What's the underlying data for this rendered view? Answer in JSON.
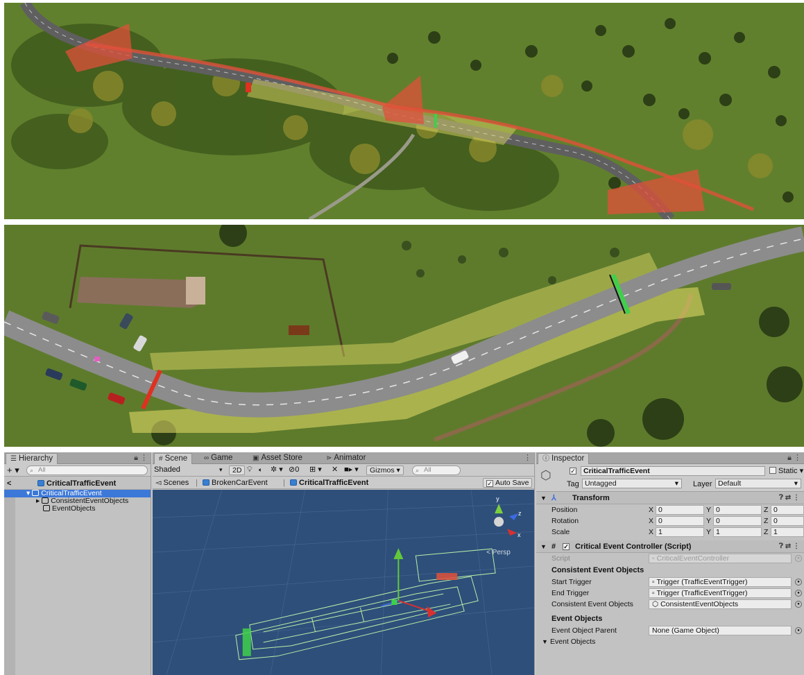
{
  "hierarchy": {
    "tab_label": "Hierarchy",
    "search_placeholder": "All",
    "scene_name": "CriticalTrafficEvent",
    "root_item": "CriticalTrafficEvent",
    "children": [
      "ConsistentEventObjects",
      "EventObjects"
    ]
  },
  "scene_panel": {
    "tabs": [
      "Scene",
      "Game",
      "Asset Store",
      "Animator"
    ],
    "shading_mode": "Shaded",
    "toggle_2d": "2D",
    "hidden_count": "0",
    "gizmos_label": "Gizmos",
    "search_placeholder": "All",
    "breadcrumbs": [
      "Scenes",
      "BrokenCarEvent",
      "CriticalTrafficEvent"
    ],
    "auto_save_label": "Auto Save",
    "projection_label": "< Persp",
    "axis_labels": [
      "y",
      "z",
      "x"
    ]
  },
  "inspector": {
    "tab_label": "Inspector",
    "object_name": "CriticalTrafficEvent",
    "static_label": "Static",
    "tag_label": "Tag",
    "tag_value": "Untagged",
    "layer_label": "Layer",
    "layer_value": "Default",
    "transform": {
      "title": "Transform",
      "rows": [
        {
          "label": "Position",
          "x": "0",
          "y": "0",
          "z": "0"
        },
        {
          "label": "Rotation",
          "x": "0",
          "y": "0",
          "z": "0"
        },
        {
          "label": "Scale",
          "x": "1",
          "y": "1",
          "z": "1"
        }
      ]
    },
    "script_component": {
      "title": "Critical Event Controller (Script)",
      "script_label": "Script",
      "script_value": "CriticalEventController",
      "section1": "Consistent Event Objects",
      "start_trigger_label": "Start Trigger",
      "start_trigger_value": "Trigger (TrafficEventTrigger)",
      "end_trigger_label": "End Trigger",
      "end_trigger_value": "Trigger (TrafficEventTrigger)",
      "consistent_objects_label": "Consistent Event Objects",
      "consistent_objects_value": "ConsistentEventObjects",
      "section2": "Event Objects",
      "parent_label": "Event Object Parent",
      "parent_value": "None (Game Object)",
      "list_label": "Event Objects"
    }
  },
  "colors": {
    "grass": "#5b7a2a",
    "road": "#7b7b7b",
    "trigger_red": "#e0503a",
    "zone_yellow": "#e9e06a",
    "marker_green": "#3ed04a",
    "viewport_bg": "#2e4f7a",
    "selection": "#3c78d8"
  },
  "icons": [
    "hierarchy-icon",
    "search-icon",
    "lock-icon",
    "kebab-menu-icon",
    "scene-icon",
    "game-icon",
    "asset-store-icon",
    "animator-icon",
    "light-icon",
    "audio-icon",
    "effects-icon",
    "visibility-icon",
    "grid-icon",
    "tools-icon",
    "camera-icon",
    "unity-cube-icon",
    "transform-icon",
    "script-icon",
    "help-icon",
    "settings-icon"
  ]
}
